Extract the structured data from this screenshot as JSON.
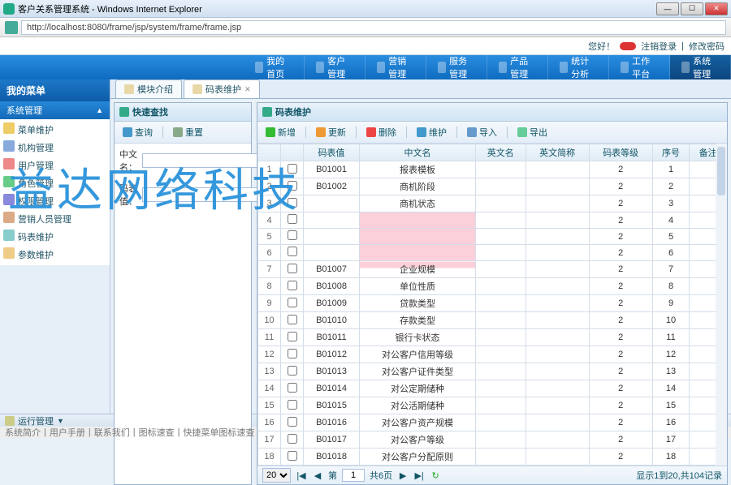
{
  "window": {
    "title": "客户关系管理系统 - Windows Internet Explorer",
    "url": "http://localhost:8080/frame/jsp/system/frame/frame.jsp"
  },
  "userbar": {
    "greet": "您好！",
    "logout": "注销登录",
    "chpwd": "修改密码"
  },
  "nav": {
    "items": [
      "我的首页",
      "客户管理",
      "营销管理",
      "服务管理",
      "产品管理",
      "统计分析",
      "工作平台",
      "系统管理"
    ],
    "active_index": 7
  },
  "sidebar": {
    "title": "我的菜单",
    "section": "系统管理",
    "items": [
      {
        "label": "菜单维护",
        "color": "#ec6"
      },
      {
        "label": "机构管理",
        "color": "#8ad"
      },
      {
        "label": "用户管理",
        "color": "#e88"
      },
      {
        "label": "角色管理",
        "color": "#6c8"
      },
      {
        "label": "权限管理",
        "color": "#88d"
      },
      {
        "label": "营销人员管理",
        "color": "#da8"
      },
      {
        "label": "码表维护",
        "color": "#8cc"
      },
      {
        "label": "参数维护",
        "color": "#ec8"
      }
    ]
  },
  "tabs": {
    "items": [
      "模块介绍",
      "码表维护"
    ],
    "active_index": 1
  },
  "searchPanel": {
    "title": "快速查找",
    "query_btn": "查询",
    "reset_btn": "重置",
    "field1_label": "中文名：",
    "field2_label": "码表值："
  },
  "gridPanel": {
    "title": "码表维护",
    "toolbar": {
      "add": "新增",
      "update": "更新",
      "delete": "删除",
      "maintain": "维护",
      "import": "导入",
      "export": "导出"
    },
    "columns": [
      "",
      "",
      "码表值",
      "中文名",
      "英文名",
      "英文简称",
      "码表等级",
      "序号",
      "备注"
    ],
    "rows": [
      {
        "idx": 1,
        "code": "B01001",
        "cn": "报表模板",
        "en": "",
        "ab": "",
        "lvl": 2,
        "seq": 1,
        "rmk": ""
      },
      {
        "idx": 2,
        "code": "B01002",
        "cn": "商机阶段",
        "en": "",
        "ab": "",
        "lvl": 2,
        "seq": 2,
        "rmk": ""
      },
      {
        "idx": 3,
        "code": "",
        "cn": "商机状态",
        "en": "",
        "ab": "",
        "lvl": 2,
        "seq": 3,
        "rmk": "",
        "codehidden": true
      },
      {
        "idx": 4,
        "code": "",
        "cn": "",
        "en": "",
        "ab": "",
        "lvl": 2,
        "seq": 4,
        "rmk": "",
        "pink": true
      },
      {
        "idx": 5,
        "code": "",
        "cn": "",
        "en": "",
        "ab": "",
        "lvl": 2,
        "seq": 5,
        "rmk": "",
        "pink": true
      },
      {
        "idx": 6,
        "code": "",
        "cn": "",
        "en": "",
        "ab": "",
        "lvl": 2,
        "seq": 6,
        "rmk": "",
        "pink": true
      },
      {
        "idx": 7,
        "code": "B01007",
        "cn": "企业规模",
        "en": "",
        "ab": "",
        "lvl": 2,
        "seq": 7,
        "rmk": "",
        "pinkpartial": true
      },
      {
        "idx": 8,
        "code": "B01008",
        "cn": "单位性质",
        "en": "",
        "ab": "",
        "lvl": 2,
        "seq": 8,
        "rmk": ""
      },
      {
        "idx": 9,
        "code": "B01009",
        "cn": "贷款类型",
        "en": "",
        "ab": "",
        "lvl": 2,
        "seq": 9,
        "rmk": ""
      },
      {
        "idx": 10,
        "code": "B01010",
        "cn": "存款类型",
        "en": "",
        "ab": "",
        "lvl": 2,
        "seq": 10,
        "rmk": ""
      },
      {
        "idx": 11,
        "code": "B01011",
        "cn": "银行卡状态",
        "en": "",
        "ab": "",
        "lvl": 2,
        "seq": 11,
        "rmk": ""
      },
      {
        "idx": 12,
        "code": "B01012",
        "cn": "对公客户信用等级",
        "en": "",
        "ab": "",
        "lvl": 2,
        "seq": 12,
        "rmk": ""
      },
      {
        "idx": 13,
        "code": "B01013",
        "cn": "对公客户证件类型",
        "en": "",
        "ab": "",
        "lvl": 2,
        "seq": 13,
        "rmk": ""
      },
      {
        "idx": 14,
        "code": "B01014",
        "cn": "对公定期储种",
        "en": "",
        "ab": "",
        "lvl": 2,
        "seq": 14,
        "rmk": ""
      },
      {
        "idx": 15,
        "code": "B01015",
        "cn": "对公活期储种",
        "en": "",
        "ab": "",
        "lvl": 2,
        "seq": 15,
        "rmk": ""
      },
      {
        "idx": 16,
        "code": "B01016",
        "cn": "对公客户资产规模",
        "en": "",
        "ab": "",
        "lvl": 2,
        "seq": 16,
        "rmk": ""
      },
      {
        "idx": 17,
        "code": "B01017",
        "cn": "对公客户等级",
        "en": "",
        "ab": "",
        "lvl": 2,
        "seq": 17,
        "rmk": ""
      },
      {
        "idx": 18,
        "code": "B01018",
        "cn": "对公客户分配原则",
        "en": "",
        "ab": "",
        "lvl": 2,
        "seq": 18,
        "rmk": ""
      }
    ],
    "pager": {
      "page_size": "20",
      "page_label_prefix": "第",
      "page": "1",
      "total_pages_label": "共6页",
      "summary": "显示1到20,共104记录"
    }
  },
  "bottom": {
    "label": "运行管理"
  },
  "footer": {
    "links": [
      "系统简介",
      "用户手册",
      "联系我们",
      "图标速查",
      "快捷菜单图标速查"
    ]
  },
  "watermark": "益达网络科技"
}
